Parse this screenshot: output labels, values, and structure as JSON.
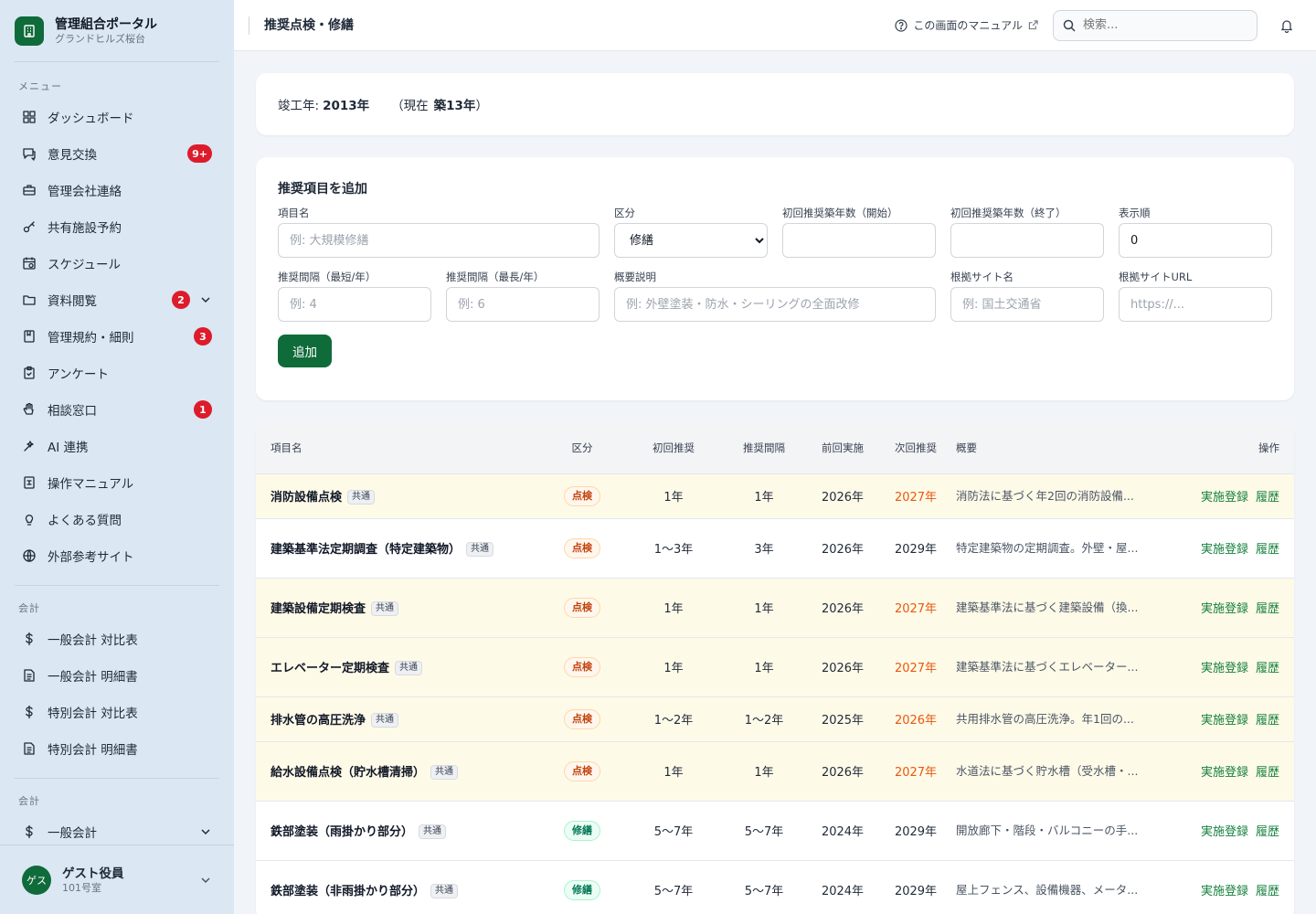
{
  "brand": {
    "title": "管理組合ポータル",
    "subtitle": "グランドヒルズ桜台"
  },
  "sidebar": {
    "menu_label": "メニュー",
    "items": [
      {
        "label": "ダッシュボード",
        "icon": "dashboard-icon"
      },
      {
        "label": "意見交換",
        "icon": "chat-icon",
        "badge": "9+"
      },
      {
        "label": "管理会社連絡",
        "icon": "briefcase-icon"
      },
      {
        "label": "共有施設予約",
        "icon": "key-icon"
      },
      {
        "label": "スケジュール",
        "icon": "calendar-icon"
      },
      {
        "label": "資料閲覧",
        "icon": "folder-icon",
        "badge": "2"
      },
      {
        "label": "管理規約・細則",
        "icon": "book-icon",
        "badge": "3"
      },
      {
        "label": "アンケート",
        "icon": "clipboard-icon"
      },
      {
        "label": "相談窓口",
        "icon": "hand-icon",
        "badge": "1"
      },
      {
        "label": "AI 連携",
        "icon": "sparkle-icon"
      },
      {
        "label": "操作マニュアル",
        "icon": "manual-icon"
      },
      {
        "label": "よくある質問",
        "icon": "bulb-icon"
      },
      {
        "label": "外部参考サイト",
        "icon": "globe-icon"
      }
    ],
    "accounting_label": "会計",
    "accounting_items": [
      {
        "label": "一般会計 対比表",
        "icon": "dollar-icon"
      },
      {
        "label": "一般会計 明細書",
        "icon": "document-icon"
      },
      {
        "label": "特別会計 対比表",
        "icon": "dollar-icon"
      },
      {
        "label": "特別会計 明細書",
        "icon": "document-icon"
      }
    ],
    "accounting2_label": "会計",
    "accounting2_items": [
      {
        "label": "一般会計",
        "icon": "dollar-icon"
      }
    ]
  },
  "user": {
    "avatar": "ゲス",
    "name": "ゲスト役員",
    "room": "101号室"
  },
  "header": {
    "title": "推奨点検・修繕",
    "manual_link": "この画面のマニュアル",
    "search_placeholder": "検索..."
  },
  "completion": {
    "label": "竣工年:",
    "year": "2013年",
    "current_prefix": "（現在",
    "age": "築13年",
    "current_suffix": "）"
  },
  "form": {
    "title": "推奨項目を追加",
    "name_label": "項目名",
    "name_placeholder": "例: 大規模修繕",
    "category_label": "区分",
    "category_value": "修繕",
    "start_label": "初回推奨築年数（開始）",
    "end_label": "初回推奨築年数（終了）",
    "order_label": "表示順",
    "order_value": "0",
    "min_label": "推奨間隔（最短/年）",
    "min_placeholder": "例: 4",
    "max_label": "推奨間隔（最長/年）",
    "max_placeholder": "例: 6",
    "desc_label": "概要説明",
    "desc_placeholder": "例: 外壁塗装・防水・シーリングの全面改修",
    "site_label": "根拠サイト名",
    "site_placeholder": "例: 国土交通省",
    "url_label": "根拠サイトURL",
    "url_placeholder": "https://...",
    "submit": "追加"
  },
  "table": {
    "headers": [
      "項目名",
      "区分",
      "初回推奨",
      "推奨間隔",
      "前回実施",
      "次回推奨",
      "概要",
      "操作"
    ],
    "action_register": "実施登録",
    "action_history": "履歴",
    "rows": [
      {
        "name": "消防設備点検",
        "tag": "共通",
        "kind": "点検",
        "first": "1年",
        "interval": "1年",
        "last": "2026年",
        "next": "2027年",
        "summary": "消防法に基づく年2回の消防設備...",
        "highlight": true
      },
      {
        "name": "建築基準法定期調査（特定建築物）",
        "tag": "共通",
        "kind": "点検",
        "first": "1〜3年",
        "interval": "3年",
        "last": "2026年",
        "next": "2029年",
        "summary": "特定建築物の定期調査。外壁・屋...",
        "highlight": false
      },
      {
        "name": "建築設備定期検査",
        "tag": "共通",
        "kind": "点検",
        "first": "1年",
        "interval": "1年",
        "last": "2026年",
        "next": "2027年",
        "summary": "建築基準法に基づく建築設備（換...",
        "highlight": true
      },
      {
        "name": "エレベーター定期検査",
        "tag": "共通",
        "kind": "点検",
        "first": "1年",
        "interval": "1年",
        "last": "2026年",
        "next": "2027年",
        "summary": "建築基準法に基づくエレベーター...",
        "highlight": true
      },
      {
        "name": "排水管の高圧洗浄",
        "tag": "共通",
        "kind": "点検",
        "first": "1〜2年",
        "interval": "1〜2年",
        "last": "2025年",
        "next": "2026年",
        "summary": "共用排水管の高圧洗浄。年1回の...",
        "highlight": true
      },
      {
        "name": "給水設備点検（貯水槽清掃）",
        "tag": "共通",
        "kind": "点検",
        "first": "1年",
        "interval": "1年",
        "last": "2026年",
        "next": "2027年",
        "summary": "水道法に基づく貯水槽（受水槽・...",
        "highlight": true
      },
      {
        "name": "鉄部塗装（雨掛かり部分）",
        "tag": "共通",
        "kind": "修繕",
        "first": "5〜7年",
        "interval": "5〜7年",
        "last": "2024年",
        "next": "2029年",
        "summary": "開放廊下・階段・バルコニーの手...",
        "highlight": false
      },
      {
        "name": "鉄部塗装（非雨掛かり部分）",
        "tag": "共通",
        "kind": "修繕",
        "first": "5〜7年",
        "interval": "5〜7年",
        "last": "2024年",
        "next": "2029年",
        "summary": "屋上フェンス、設備機器、メータ...",
        "highlight": false
      }
    ]
  },
  "colors": {
    "brand": "#0f6b3a",
    "badge": "#dc1c2b",
    "next_due": "#ea580c",
    "link": "#15803d",
    "highlight_row": "#fefae8"
  }
}
